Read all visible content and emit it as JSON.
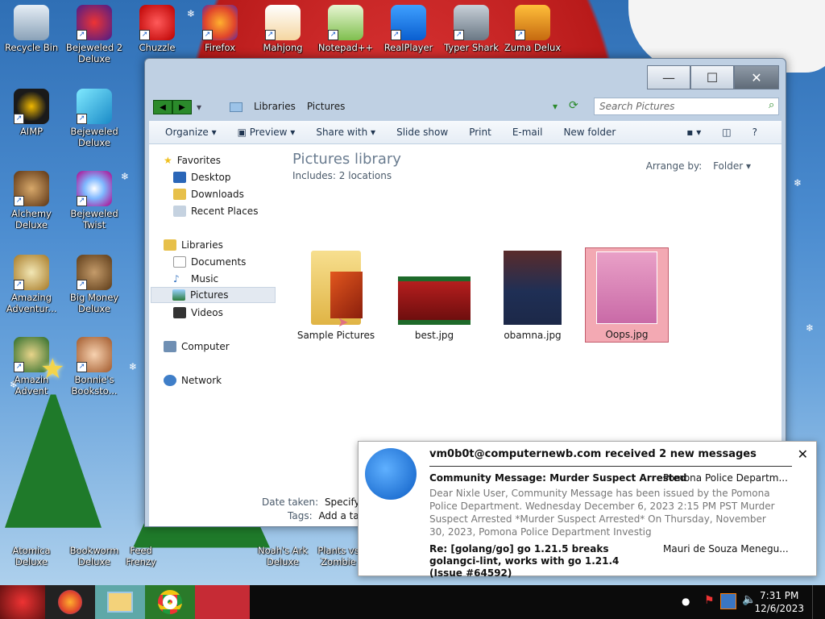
{
  "desktop": {
    "icons": [
      {
        "label": "Recycle Bin"
      },
      {
        "label": "Bejeweled 2 Deluxe"
      },
      {
        "label": "Chuzzle"
      },
      {
        "label": "Firefox"
      },
      {
        "label": "Mahjong"
      },
      {
        "label": "Notepad++"
      },
      {
        "label": "RealPlayer"
      },
      {
        "label": "Typer Shark"
      },
      {
        "label": "Zuma Delux"
      },
      {
        "label": "AIMP"
      },
      {
        "label": "Bejeweled Deluxe"
      },
      {
        "label": "Alchemy Deluxe"
      },
      {
        "label": "Bejeweled Twist"
      },
      {
        "label": "Amazing Adventur..."
      },
      {
        "label": "Big Money Deluxe"
      },
      {
        "label": "Amazin Advent"
      },
      {
        "label": "Bonnie's Booksto..."
      },
      {
        "label": "Atomica Deluxe"
      },
      {
        "label": "Bookworm Deluxe"
      },
      {
        "label": "Feed Frenzy"
      },
      {
        "label": "Noah's Ark Deluxe"
      },
      {
        "label": "Plants vs Zombie"
      }
    ]
  },
  "explorer": {
    "breadcrumb": [
      "Libraries",
      "Pictures"
    ],
    "search_placeholder": "Search Pictures",
    "toolbar": {
      "organize": "Organize",
      "preview": "Preview",
      "share_with": "Share with",
      "slide_show": "Slide show",
      "print": "Print",
      "email": "E-mail",
      "new_folder": "New folder",
      "help": "?"
    },
    "nav": {
      "favorites": "Favorites",
      "desktop": "Desktop",
      "downloads": "Downloads",
      "recent_places": "Recent Places",
      "libraries": "Libraries",
      "documents": "Documents",
      "music": "Music",
      "pictures": "Pictures",
      "videos": "Videos",
      "computer": "Computer",
      "network": "Network"
    },
    "library_title": "Pictures library",
    "library_includes": "Includes:  2 locations",
    "arrange_by_label": "Arrange by:",
    "arrange_by_value": "Folder",
    "files": [
      {
        "name": "Sample Pictures",
        "selected": false
      },
      {
        "name": "best.jpg",
        "selected": false
      },
      {
        "name": "obamna.jpg",
        "selected": false
      },
      {
        "name": "Oops.jpg",
        "selected": true
      }
    ],
    "details": {
      "date_taken_label": "Date taken:",
      "date_taken_value": "Specify da",
      "tags_label": "Tags:",
      "tags_value": "Add a tag"
    }
  },
  "notification": {
    "header": "vm0b0t@computernewb.com received 2 new messages",
    "close": "✕",
    "messages": [
      {
        "subject": "Community Message: Murder Suspect Arrested",
        "from": "Pomona Police Departm...",
        "preview": "Dear Nixle User, Community Message has been issued by the Pomona Police Department. Wednesday December 6, 2023 2:15 PM PST Murder Suspect Arrested *Murder Suspect Arrested* On Thursday, November 30, 2023, Pomona Police Department Investig"
      },
      {
        "subject": "Re: [golang/go] go 1.21.5 breaks golangci-lint, works with go 1.21.4 (Issue #64592)",
        "from": "Mauri de Souza Menegu..."
      }
    ]
  },
  "taskbar": {
    "time": "7:31 PM",
    "date": "12/6/2023"
  }
}
